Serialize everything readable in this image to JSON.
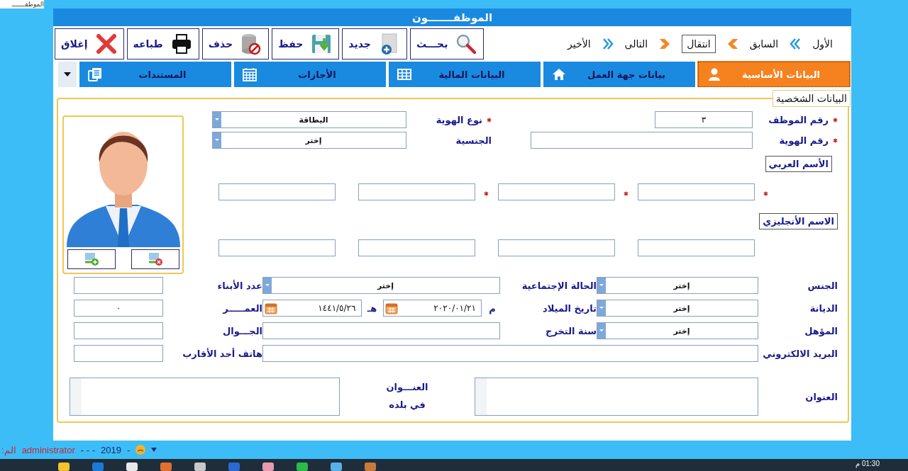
{
  "top_tab": {
    "label": "الموظفـــــــ"
  },
  "window": {
    "title": "الموظفـــــــون"
  },
  "nav": [
    {
      "label": "الأول",
      "kind": "link"
    },
    {
      "label": "السابق",
      "kind": "link"
    },
    {
      "label": "انتقال",
      "kind": "box"
    },
    {
      "label": "التالى",
      "kind": "link"
    },
    {
      "label": "الأخير",
      "kind": "link"
    }
  ],
  "toolbar_buttons": [
    {
      "label": "بحـــث",
      "kind": "search"
    },
    {
      "label": "جديد",
      "kind": "new"
    },
    {
      "label": "حفظ",
      "kind": "save"
    },
    {
      "label": "حذف",
      "kind": "delete"
    },
    {
      "label": "طباعه",
      "kind": "print"
    },
    {
      "label": "إغلاق",
      "kind": "close"
    }
  ],
  "tabs": [
    {
      "label": "البيانات الأساسية",
      "kind": "person",
      "selected": true
    },
    {
      "label": "بيانات جهة العمل",
      "kind": "home",
      "selected": false
    },
    {
      "label": "البيانات المالية",
      "kind": "table",
      "selected": false
    },
    {
      "label": "الأجازات",
      "kind": "calendar",
      "selected": false
    },
    {
      "label": "المستندات",
      "kind": "documents",
      "selected": false
    }
  ],
  "personal_data": {
    "legend": "البيانات الشخصية",
    "employee_number": {
      "label": "رقم الموظف",
      "required": true,
      "value": "٣"
    },
    "id_type": {
      "label": "نوع الهوية",
      "required": true,
      "value": "البطاقة"
    },
    "id_number": {
      "label": "رقم الهوية",
      "required": true
    },
    "nationality": {
      "label": "الجنسية",
      "required": false,
      "value": "إختر"
    },
    "arabic_name": {
      "label": "الأسم العربي",
      "parts": [
        {
          "required": true
        },
        {
          "required": true
        },
        {
          "required": true
        },
        {
          "required": false
        }
      ]
    },
    "english_name": {
      "label": "الاسم الأنجليزي",
      "parts": [
        {
          "required": false
        },
        {
          "required": false
        },
        {
          "required": false
        },
        {
          "required": false
        }
      ]
    },
    "rows": [
      [
        {
          "kind": "select",
          "label": "الجنس",
          "value": "إختر"
        },
        {
          "kind": "select",
          "label": "الحالة الإجتماعية",
          "value": "إختر"
        },
        {
          "kind": "text",
          "label": "عدد الأبناء"
        }
      ],
      [
        {
          "kind": "select",
          "label": "الديانة",
          "value": "إختر"
        },
        {
          "kind": "dates",
          "label": "تاريخ الميلاد",
          "gregorian_mark": "م",
          "gregorian": "٢٠٢٠/٠١/٢١",
          "hijri_mark": "هـ",
          "hijri": "١٤٤١/٥/٢٦"
        },
        {
          "kind": "text",
          "label": "العمـــــر",
          "value": "٠"
        }
      ],
      [
        {
          "kind": "select",
          "label": "المؤهل",
          "value": "إختر"
        },
        {
          "kind": "text",
          "label": "سنة التخرج"
        },
        {
          "kind": "text",
          "label": "الجـــوال"
        }
      ]
    ],
    "email": {
      "label": "البريد الالكتروني"
    },
    "relative_phone": {
      "label": "هاتف أحد الأقارب"
    },
    "address": {
      "label": "العنوان"
    },
    "home_address": {
      "label": "العنـــوان\nفي بلده"
    }
  },
  "status_bar": {
    "cut_label": "الم:",
    "user": "administrator",
    "dashes": "- - -",
    "year": "2019",
    "trail": "-"
  },
  "taskbar": {
    "clock": "01:30 م"
  }
}
